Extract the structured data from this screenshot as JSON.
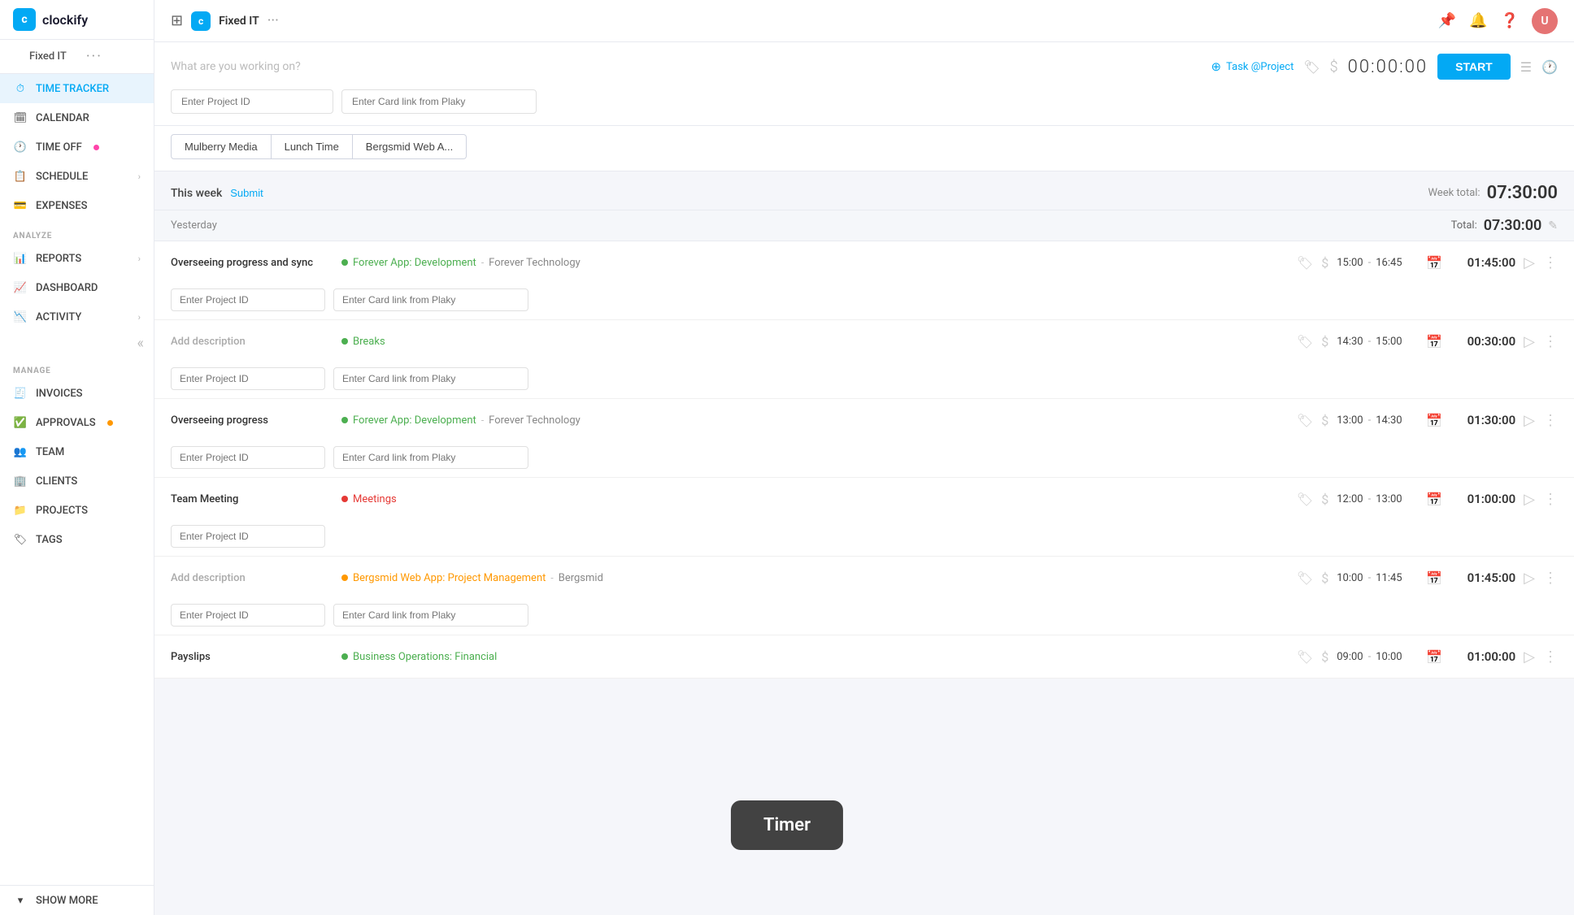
{
  "app": {
    "brand": "clockify",
    "workspace": "Fixed IT",
    "workspace_dots": "···",
    "avatar_initials": "U"
  },
  "sidebar": {
    "sections": [
      {
        "items": [
          {
            "id": "time-tracker",
            "label": "TIME TRACKER",
            "icon": "⏱",
            "active": true
          },
          {
            "id": "calendar",
            "label": "CALENDAR",
            "icon": "📅"
          },
          {
            "id": "time-off",
            "label": "TIME OFF",
            "icon": "🕐",
            "badge": true
          },
          {
            "id": "schedule",
            "label": "SCHEDULE",
            "icon": "📋",
            "chevron": true
          },
          {
            "id": "expenses",
            "label": "EXPENSES",
            "icon": "💳"
          }
        ]
      },
      {
        "label": "ANALYZE",
        "items": [
          {
            "id": "reports",
            "label": "REPORTS",
            "icon": "📊",
            "chevron": true
          },
          {
            "id": "dashboard",
            "label": "DASHBOARD",
            "icon": "📈"
          },
          {
            "id": "activity",
            "label": "ACTIVITY",
            "icon": "📉",
            "chevron": true
          }
        ]
      },
      {
        "label": "MANAGE",
        "items": [
          {
            "id": "invoices",
            "label": "INVOICES",
            "icon": "🧾"
          },
          {
            "id": "approvals",
            "label": "APPROVALS",
            "icon": "✅",
            "badge_orange": true
          },
          {
            "id": "team",
            "label": "TEAM",
            "icon": "👥"
          },
          {
            "id": "clients",
            "label": "CLIENTS",
            "icon": "🏢"
          },
          {
            "id": "projects",
            "label": "PROJECTS",
            "icon": "📁"
          },
          {
            "id": "tags",
            "label": "TAGS",
            "icon": "🏷"
          }
        ]
      }
    ],
    "show_more": "SHOW MORE"
  },
  "timer_bar": {
    "description_placeholder": "What are you working on?",
    "task_label": "Task @Project",
    "timer_display": "00:00:00",
    "start_label": "START",
    "project_id_placeholder": "Enter Project ID",
    "card_link_placeholder": "Enter Card link from Plaky"
  },
  "recent_projects": [
    {
      "label": "Mulberry Media"
    },
    {
      "label": "Lunch Time"
    },
    {
      "label": "Bergsmid Web A..."
    }
  ],
  "week": {
    "label": "This week",
    "submit": "Submit",
    "total_label": "Week total:",
    "total_time": "07:30:00"
  },
  "day_groups": [
    {
      "label": "Yesterday",
      "total_label": "Total:",
      "total_time": "07:30:00",
      "entries": [
        {
          "description": "Overseeing progress and sync",
          "project_name": "Forever App: Development",
          "project_color": "#4caf50",
          "project_class": "green",
          "separator": "-",
          "client": "Forever Technology",
          "time_start": "15:00",
          "time_end": "16:45",
          "duration": "01:45:00",
          "has_inputs": true,
          "project_id_placeholder": "Enter Project ID",
          "card_link_placeholder": "Enter Card link from Plaky"
        },
        {
          "description": "Add description",
          "description_muted": true,
          "project_name": "Breaks",
          "project_color": "#4caf50",
          "project_class": "green",
          "separator": "",
          "client": "",
          "time_start": "14:30",
          "time_end": "15:00",
          "duration": "00:30:00",
          "has_inputs": true,
          "project_id_placeholder": "Enter Project ID",
          "card_link_placeholder": "Enter Card link from Plaky"
        },
        {
          "description": "Overseeing progress",
          "project_name": "Forever App: Development",
          "project_color": "#4caf50",
          "project_class": "green",
          "separator": "-",
          "client": "Forever Technology",
          "time_start": "13:00",
          "time_end": "14:30",
          "duration": "01:30:00",
          "has_inputs": true,
          "project_id_placeholder": "Enter Project ID",
          "card_link_placeholder": "Enter Card link from Plaky"
        },
        {
          "description": "Team Meeting",
          "project_name": "Meetings",
          "project_color": "#e53935",
          "project_class": "red",
          "separator": "",
          "client": "",
          "time_start": "12:00",
          "time_end": "13:00",
          "duration": "01:00:00",
          "has_inputs": true,
          "project_id_placeholder": "Enter Project ID",
          "card_link_placeholder": "",
          "card_link_hidden": true
        },
        {
          "description": "Add description",
          "description_muted": true,
          "project_name": "Bergsmid Web App: Project Management",
          "project_color": "#ff9800",
          "project_class": "orange",
          "separator": "-",
          "client": "Bergsmid",
          "time_start": "10:00",
          "time_end": "11:45",
          "duration": "01:45:00",
          "has_inputs": true,
          "project_id_placeholder": "Enter Project ID",
          "card_link_placeholder": "Enter Card link from Plaky"
        },
        {
          "description": "Payslips",
          "project_name": "Business Operations: Financial",
          "project_color": "#4caf50",
          "project_class": "green",
          "separator": "",
          "client": "",
          "time_start": "09:00",
          "time_end": "10:00",
          "duration": "01:00:00",
          "has_inputs": false
        }
      ]
    }
  ],
  "timer_tooltip": {
    "label": "Timer"
  }
}
